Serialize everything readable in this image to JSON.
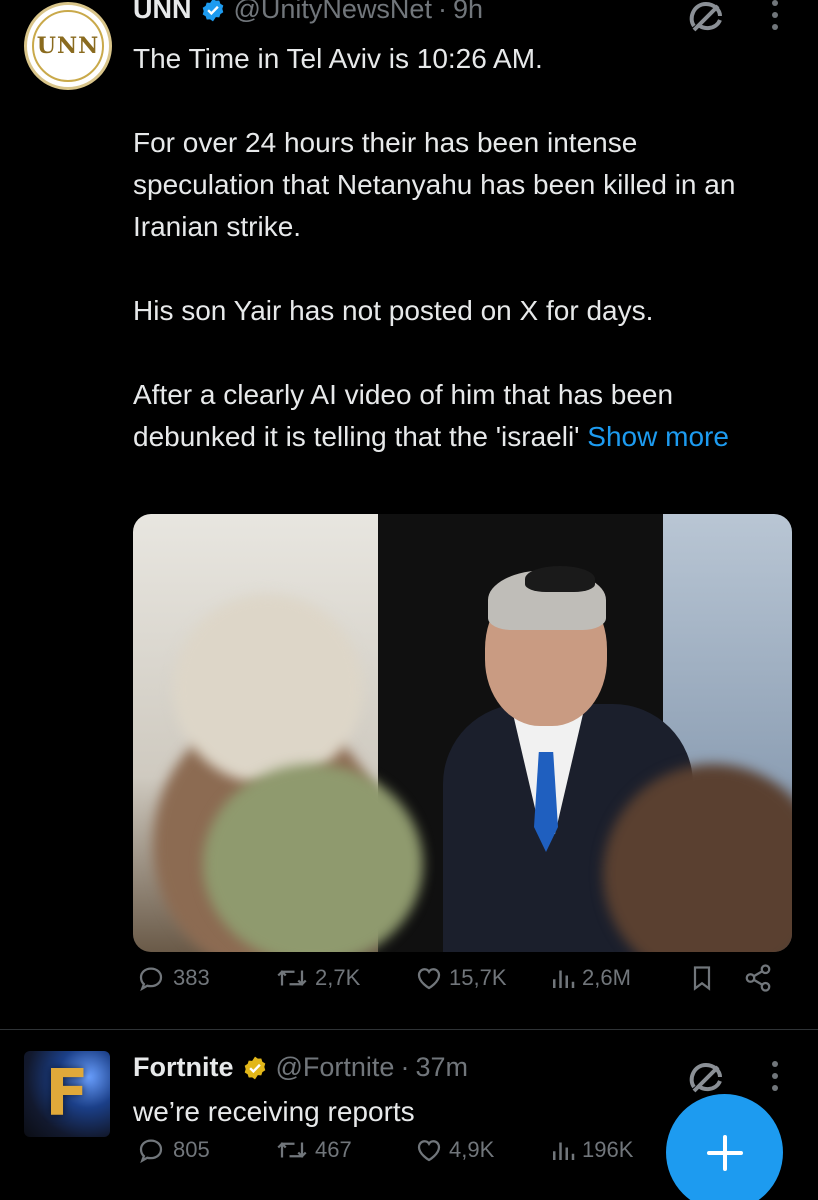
{
  "tweets": [
    {
      "avatar_text": "UNN",
      "name": "UNN",
      "handle": "@UnityNewsNet",
      "time": "9h",
      "paragraphs": [
        "The Time in Tel Aviv is 10:26 AM.",
        "For over 24 hours their has been intense speculation that Netanyahu has been killed in an Iranian strike.",
        "His son Yair has not posted on X for days."
      ],
      "last_paragraph": "After a clearly AI video of him that has been debunked it is telling that the 'israeli' ",
      "show_more": "Show more",
      "stats": {
        "replies": "383",
        "reposts": "2,7K",
        "likes": "15,7K",
        "views": "2,6M"
      }
    },
    {
      "avatar_text": "F",
      "name": "Fortnite",
      "handle": "@Fortnite",
      "time": "37m",
      "text": "we’re receiving reports",
      "stats": {
        "replies": "805",
        "reposts": "467",
        "likes": "4,9K",
        "views": "196K"
      }
    }
  ],
  "colors": {
    "accent": "#1d9bf0",
    "muted": "#71767b",
    "gold_badge": "#e2b719",
    "blue_badge": "#1d9bf0"
  },
  "icons": [
    "verified-badge-icon",
    "grok-icon",
    "more-icon",
    "reply-icon",
    "repost-icon",
    "like-icon",
    "views-icon",
    "bookmark-icon",
    "share-icon",
    "compose-plus-icon"
  ]
}
